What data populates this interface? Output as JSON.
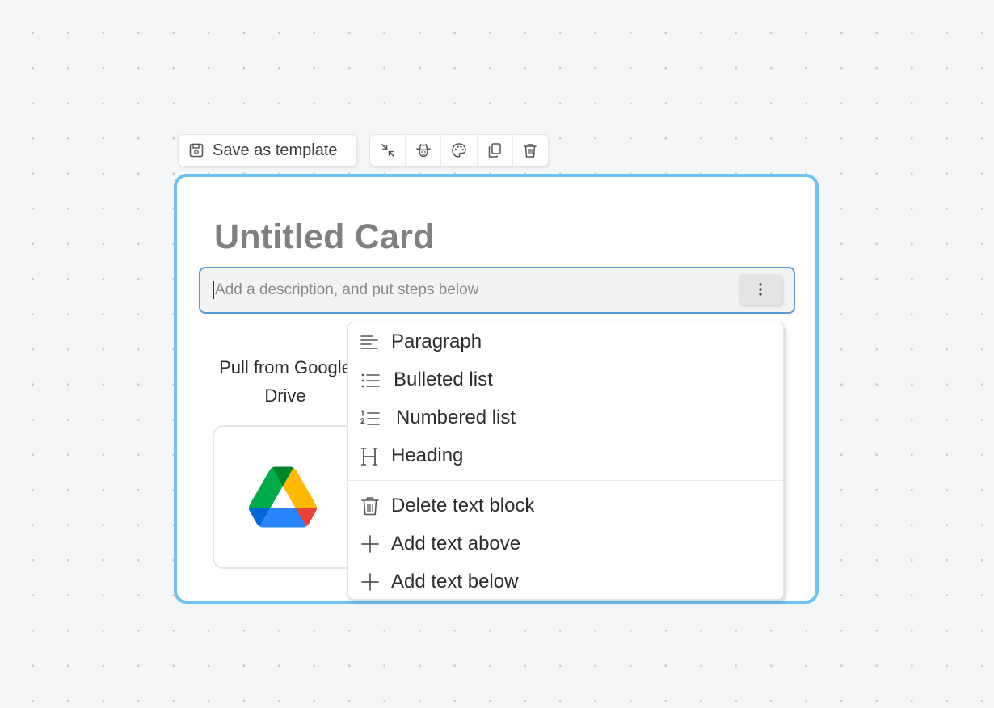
{
  "toolbar": {
    "save_template_label": "Save as template",
    "save_icon": "floppy-disk-icon",
    "tools": [
      {
        "name": "collapse-icon"
      },
      {
        "name": "cowboy-icon"
      },
      {
        "name": "palette-icon"
      },
      {
        "name": "duplicate-icon"
      },
      {
        "name": "trash-icon"
      }
    ]
  },
  "card": {
    "title": "Untitled Card",
    "description": {
      "value": "",
      "placeholder": "Add a description, and put steps below"
    },
    "integration": {
      "label_line1": "Pull from Google",
      "label_line2": "Drive",
      "icon": "google-drive-icon"
    }
  },
  "menu": {
    "items": [
      {
        "label": "Paragraph",
        "icon": "paragraph-icon"
      },
      {
        "label": "Bulleted list",
        "icon": "bulleted-list-icon"
      },
      {
        "label": "Numbered list",
        "icon": "numbered-list-icon"
      },
      {
        "label": "Heading",
        "icon": "heading-icon"
      },
      {
        "label": "Delete text block",
        "icon": "trash-icon"
      },
      {
        "label": "Add text above",
        "icon": "plus-icon"
      },
      {
        "label": "Add text below",
        "icon": "plus-icon"
      }
    ]
  },
  "colors": {
    "card_border": "#6cc3f4",
    "input_border": "#5c9ad6",
    "title_text": "#808080",
    "canvas_background": "#f5f6f7"
  }
}
